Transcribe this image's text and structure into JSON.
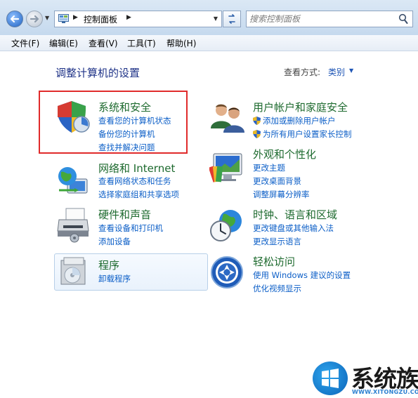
{
  "address_bar": {
    "breadcrumb": "控制面板",
    "search_placeholder": "搜索控制面板"
  },
  "menu": [
    {
      "label": "文件(F)"
    },
    {
      "label": "编辑(E)"
    },
    {
      "label": "查看(V)"
    },
    {
      "label": "工具(T)"
    },
    {
      "label": "帮助(H)"
    }
  ],
  "content": {
    "heading": "调整计算机的设置",
    "view_by_label": "查看方式:",
    "view_by_value": "类别"
  },
  "categories": {
    "system_security": {
      "title": "系统和安全",
      "links": [
        "查看您的计算机状态",
        "备份您的计算机",
        "查找并解决问题"
      ],
      "icon": "shield-icon",
      "highlighted": true
    },
    "network": {
      "title": "网络和 Internet",
      "links": [
        "查看网络状态和任务",
        "选择家庭组和共享选项"
      ],
      "icon": "globe-network-icon"
    },
    "hardware": {
      "title": "硬件和声音",
      "links": [
        "查看设备和打印机",
        "添加设备"
      ],
      "icon": "printer-icon"
    },
    "programs": {
      "title": "程序",
      "links": [
        "卸载程序"
      ],
      "icon": "programs-icon"
    },
    "user_accounts": {
      "title": "用户帐户和家庭安全",
      "links": [
        "添加或删除用户帐户",
        "为所有用户设置家长控制"
      ],
      "icon": "users-icon"
    },
    "appearance": {
      "title": "外观和个性化",
      "links": [
        "更改主题",
        "更改桌面背景",
        "调整屏幕分辨率"
      ],
      "icon": "monitor-palette-icon"
    },
    "clock": {
      "title": "时钟、语言和区域",
      "links": [
        "更改键盘或其他输入法",
        "更改显示语言"
      ],
      "icon": "clock-globe-icon"
    },
    "ease": {
      "title": "轻松访问",
      "links": [
        "使用 Windows 建议的设置",
        "优化视频显示"
      ],
      "icon": "ease-of-access-icon"
    }
  },
  "watermark": {
    "text": "系统族",
    "sub": "WWW.XITONGZU.COM"
  },
  "colors": {
    "category_title": "#1d6a2e",
    "link": "#0b5ec7",
    "highlight_border": "#e02b2b"
  }
}
